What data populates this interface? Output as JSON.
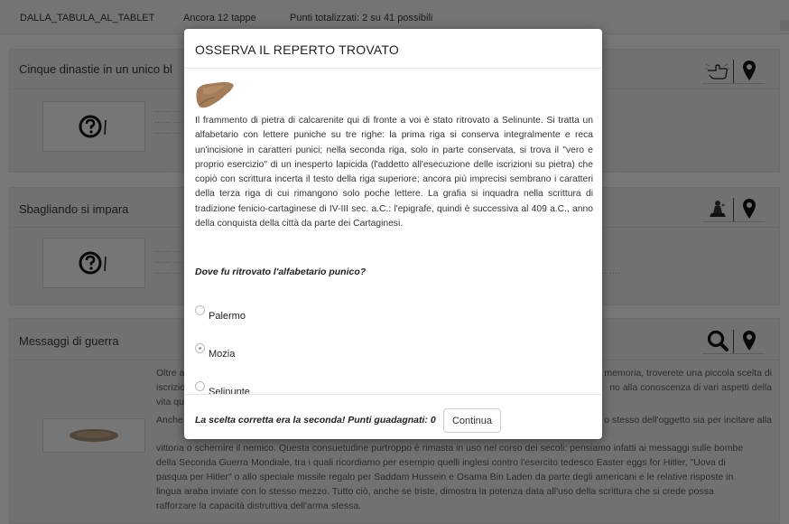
{
  "topbar": {
    "course": "DALLA_TABULA_AL_TABLET",
    "remaining": "Ancora 12 tappe",
    "score": "Punti totalizzati: 2 su 41 possibili"
  },
  "cards": [
    {
      "title": "Cinque dinastie in un unico bl",
      "dots": "...... ....... ....... ......."
    },
    {
      "title": "Sbagliando si impara",
      "dots": "...... ....... ....... ......."
    },
    {
      "title": "Messaggi di guerra"
    }
  ],
  "card3_text": {
    "left_p1": "Oltre a",
    "left_p1b": "iscrizio",
    "left_p1c": "vita qu",
    "left_p2": "Anche",
    "right_p1": "memoria, troverete una piccola scelta di",
    "right_p1b": "no alla conoscenza di vari aspetti della",
    "right_p2": "o stesso dell'oggetto sia per incitare alla",
    "full_lines": [
      "vittoria o schernire il nemico. Questa consuetudine purtroppo è rimasta in uso nel corso dei secoli: pensiamo infatti ai messaggi sulle bombe",
      "della Seconda Guerra Mondiale, tra i quali ricordiamo per esempio quelli inglesi contro l'esercito tedesco Easter eggs for Hitler, \"Uova di",
      "pasqua per Hitler\" o allo speciale missile regalo per Saddam Hussein e Osama Bin Laden da parte degli americani e le relative risposte in",
      "lingua araba inviate con lo stesso mezzo. Tutto ciò, anche se triste, dimostra la potenza data all'uso della scrittura che si crede possa",
      "rafforzare la capacità distruttiva dell'arma stessa."
    ]
  },
  "modal": {
    "title": "OSSERVA IL REPERTO TROVATO",
    "description": "Il frammento di pietra di calcarenite qui di fronte a voi è stato ritrovato a Selinunte. Si tratta un alfabetario con lettere puniche su tre righe: la prima riga si conserva integralmente e reca un'incisione in caratteri punici; nella seconda riga, solo in parte conservata, si trova il \"vero e proprio esercizio\" di un inesperto lapicida (l'addetto all'esecuzione delle iscrizioni su pietra) che copiò con scrittura incerta il testo della riga superiore; ancora più imprecisi sembrano i caratteri della terza riga di cui rimangono solo poche lettere. La grafia si inquadra nella scrittura di tradizione fenicio-cartaginese di IV-III sec. a.C.: l'epigrafe, quindi è successiva al 409 a.C., anno della conquista della città da parte dei Cartaginesi.",
    "question": "Dove fu ritrovato l'alfabetario punico?",
    "options": [
      "Palermo",
      "Mozia",
      "Selinunte"
    ],
    "selected": "Mozia",
    "result": "La scelta corretta era la seconda! Punti guadagnati: 0",
    "continue_label": "Continua"
  },
  "icons": [
    "touch-hand-icon",
    "location-pin-icon",
    "trophy-icon",
    "location-pin-icon",
    "magnifier-icon",
    "location-pin-icon",
    "question-icon",
    "stone-fragment-icon"
  ]
}
